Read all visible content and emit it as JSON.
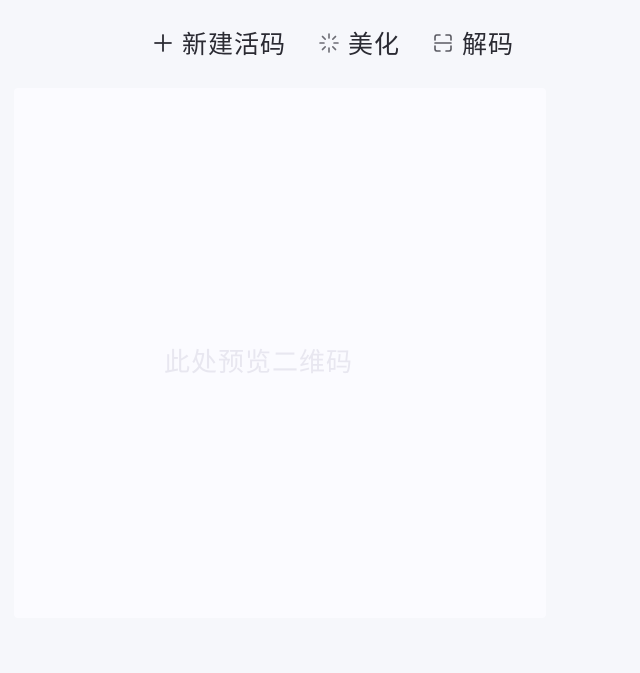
{
  "toolbar": {
    "new_label": "新建活码",
    "beautify_label": "美化",
    "decode_label": "解码"
  },
  "icons": {
    "new": "plus-icon",
    "beautify": "sparkle-icon",
    "decode": "scan-icon"
  },
  "preview": {
    "placeholder": "此处预览二维码"
  },
  "colors": {
    "background": "#f6f7fb",
    "preview_bg": "#fbfbff",
    "text": "#2b2b33",
    "placeholder": "#e8e7f0"
  }
}
